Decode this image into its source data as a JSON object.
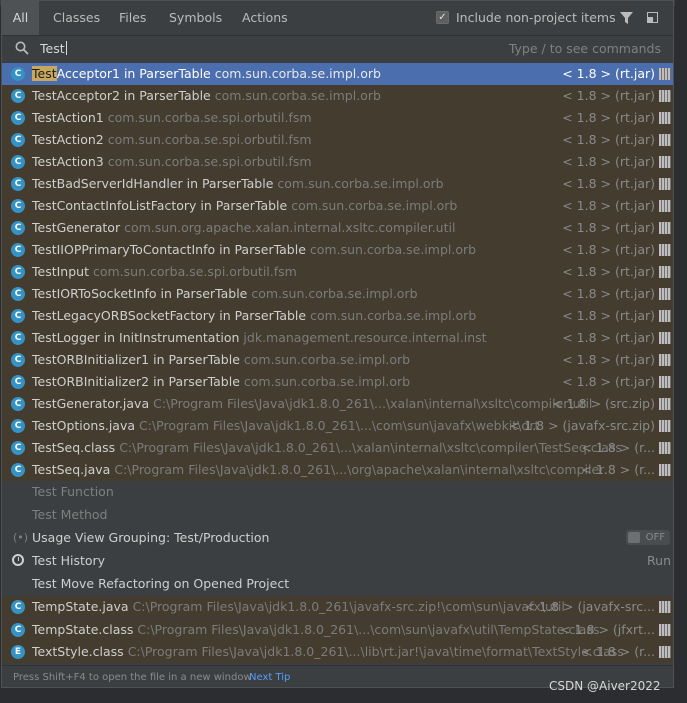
{
  "tabs": [
    {
      "label": "All",
      "active": true
    },
    {
      "label": "Classes"
    },
    {
      "label": "Files"
    },
    {
      "label": "Symbols"
    },
    {
      "label": "Actions"
    }
  ],
  "include_non_project": {
    "label": "Include non-project items",
    "checked": true
  },
  "search": {
    "value": "Test",
    "hint": "Type / to see commands"
  },
  "results": [
    {
      "kind": "class",
      "hl": "Test",
      "rest": "Acceptor1 in ParserTable",
      "loc": "com.sun.corba.se.impl.orb",
      "lib": "< 1.8 > (rt.jar)",
      "selected": true
    },
    {
      "kind": "class",
      "hl": "",
      "rest": "TestAcceptor2 in ParserTable",
      "loc": "com.sun.corba.se.impl.orb",
      "lib": "< 1.8 > (rt.jar)"
    },
    {
      "kind": "class",
      "hl": "",
      "rest": "TestAction1",
      "loc": "com.sun.corba.se.spi.orbutil.fsm",
      "lib": "< 1.8 > (rt.jar)"
    },
    {
      "kind": "class",
      "hl": "",
      "rest": "TestAction2",
      "loc": "com.sun.corba.se.spi.orbutil.fsm",
      "lib": "< 1.8 > (rt.jar)"
    },
    {
      "kind": "class",
      "hl": "",
      "rest": "TestAction3",
      "loc": "com.sun.corba.se.spi.orbutil.fsm",
      "lib": "< 1.8 > (rt.jar)"
    },
    {
      "kind": "class",
      "hl": "",
      "rest": "TestBadServerIdHandler in ParserTable",
      "loc": "com.sun.corba.se.impl.orb",
      "lib": "< 1.8 > (rt.jar)"
    },
    {
      "kind": "class",
      "hl": "",
      "rest": "TestContactInfoListFactory in ParserTable",
      "loc": "com.sun.corba.se.impl.orb",
      "lib": "< 1.8 > (rt.jar)"
    },
    {
      "kind": "class",
      "hl": "",
      "rest": "TestGenerator",
      "loc": "com.sun.org.apache.xalan.internal.xsltc.compiler.util",
      "lib": "< 1.8 > (rt.jar)"
    },
    {
      "kind": "class",
      "hl": "",
      "rest": "TestIIOPPrimaryToContactInfo in ParserTable",
      "loc": "com.sun.corba.se.impl.orb",
      "lib": "< 1.8 > (rt.jar)"
    },
    {
      "kind": "class",
      "hl": "",
      "rest": "TestInput",
      "loc": "com.sun.corba.se.spi.orbutil.fsm",
      "lib": "< 1.8 > (rt.jar)"
    },
    {
      "kind": "class",
      "hl": "",
      "rest": "TestIORToSocketInfo in ParserTable",
      "loc": "com.sun.corba.se.impl.orb",
      "lib": "< 1.8 > (rt.jar)"
    },
    {
      "kind": "class",
      "hl": "",
      "rest": "TestLegacyORBSocketFactory in ParserTable",
      "loc": "com.sun.corba.se.impl.orb",
      "lib": "< 1.8 > (rt.jar)"
    },
    {
      "kind": "class",
      "hl": "",
      "rest": "TestLogger in InitInstrumentation",
      "loc": "jdk.management.resource.internal.inst",
      "lib": "< 1.8 > (rt.jar)"
    },
    {
      "kind": "class",
      "hl": "",
      "rest": "TestORBInitializer1 in ParserTable",
      "loc": "com.sun.corba.se.impl.orb",
      "lib": "< 1.8 > (rt.jar)"
    },
    {
      "kind": "class",
      "hl": "",
      "rest": "TestORBInitializer2 in ParserTable",
      "loc": "com.sun.corba.se.impl.orb",
      "lib": "< 1.8 > (rt.jar)"
    },
    {
      "kind": "class",
      "hl": "",
      "rest": "TestGenerator.java",
      "loc": "C:\\Program Files\\Java\\jdk1.8.0_261\\...\\xalan\\internal\\xsltc\\compiler\\util",
      "lib": "< 1.8 > (src.zip)"
    },
    {
      "kind": "class",
      "hl": "",
      "rest": "TestOptions.java",
      "loc": "C:\\Program Files\\Java\\jdk1.8.0_261\\...\\com\\sun\\javafx\\webkit\\drt",
      "lib": "< 1.8 > (javafx-src.zip)"
    },
    {
      "kind": "class",
      "hl": "",
      "rest": "TestSeq.class",
      "loc": "C:\\Program Files\\Java\\jdk1.8.0_261\\...\\xalan\\internal\\xsltc\\compiler\\TestSeq.class",
      "lib": "< 1.8 > (r..."
    },
    {
      "kind": "class",
      "hl": "",
      "rest": "TestSeq.java",
      "loc": "C:\\Program Files\\Java\\jdk1.8.0_261\\...\\org\\apache\\xalan\\internal\\xsltc\\compiler",
      "lib": "< 1.8 > (r..."
    },
    {
      "kind": "cmd",
      "dim": true,
      "rest": "Test Function"
    },
    {
      "kind": "cmd",
      "dim": true,
      "rest": "Test Method"
    },
    {
      "kind": "toggle",
      "rest": "Usage View Grouping: Test/Production",
      "toggle": "OFF"
    },
    {
      "kind": "history",
      "rest": "Test History",
      "right": "Run"
    },
    {
      "kind": "cmd",
      "rest": "Test Move Refactoring on Opened Project"
    },
    {
      "kind": "class",
      "hl": "",
      "rest": "TempState.java",
      "loc": "C:\\Program Files\\Java\\jdk1.8.0_261\\javafx-src.zip!\\com\\sun\\javafx\\util",
      "lib": "< 1.8 > (javafx-src..."
    },
    {
      "kind": "class",
      "hl": "",
      "rest": "TempState.class",
      "loc": "C:\\Program Files\\Java\\jdk1.8.0_261\\...\\com\\sun\\javafx\\util\\TempState.class",
      "lib": "< 1.8 > (jfxrt..."
    },
    {
      "kind": "enum",
      "hl": "",
      "rest": "TextStyle.class",
      "loc": "C:\\Program Files\\Java\\jdk1.8.0_261\\...\\lib\\rt.jar!\\java\\time\\format\\TextStyle.class",
      "lib": "< 1.8 > (r..."
    }
  ],
  "icon_letters": {
    "class": "C",
    "enum": "E"
  },
  "status": {
    "tip": "Press Shift+F4 to open the file in a new window",
    "next_tip": "Next Tip"
  },
  "watermark": "CSDN @Aiver2022"
}
